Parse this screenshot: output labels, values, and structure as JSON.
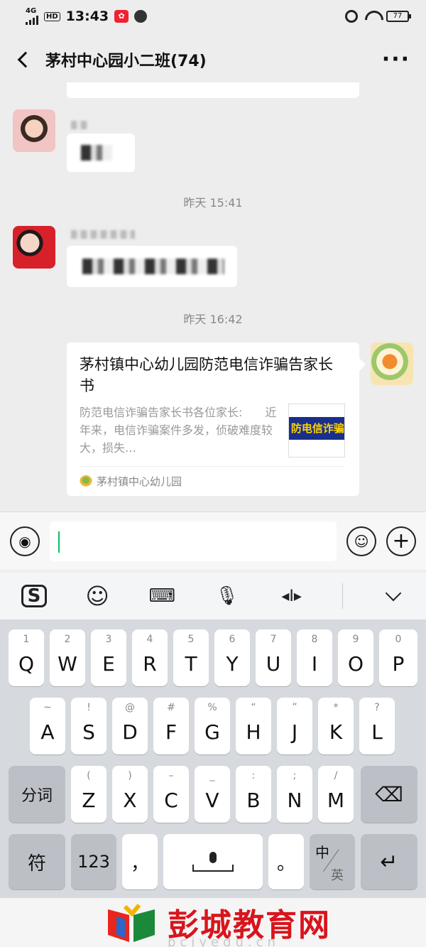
{
  "status": {
    "network": "4G",
    "hd": "HD",
    "time": "13:43",
    "battery": "77"
  },
  "header": {
    "title": "茅村中心园小二班(74)"
  },
  "chat": {
    "timestamps": [
      "昨天 15:41",
      "昨天 16:42"
    ],
    "card": {
      "title": "茅村镇中心幼儿园防范电信诈骗告家长书",
      "description": "防范电信诈骗告家长书各位家长:　　近年来，电信诈骗案件多发，侦破难度较大，损失…",
      "thumb_text": "防电信诈骗",
      "source": "茅村镇中心幼儿园"
    }
  },
  "keyboard": {
    "row1": [
      {
        "num": "1",
        "letter": "Q"
      },
      {
        "num": "2",
        "letter": "W"
      },
      {
        "num": "3",
        "letter": "E"
      },
      {
        "num": "4",
        "letter": "R"
      },
      {
        "num": "5",
        "letter": "T"
      },
      {
        "num": "6",
        "letter": "Y"
      },
      {
        "num": "7",
        "letter": "U"
      },
      {
        "num": "8",
        "letter": "I"
      },
      {
        "num": "9",
        "letter": "O"
      },
      {
        "num": "0",
        "letter": "P"
      }
    ],
    "row2": [
      {
        "num": "~",
        "letter": "A"
      },
      {
        "num": "!",
        "letter": "S"
      },
      {
        "num": "@",
        "letter": "D"
      },
      {
        "num": "#",
        "letter": "F"
      },
      {
        "num": "%",
        "letter": "G"
      },
      {
        "num": "“",
        "letter": "H"
      },
      {
        "num": "”",
        "letter": "J"
      },
      {
        "num": "*",
        "letter": "K"
      },
      {
        "num": "?",
        "letter": "L"
      }
    ],
    "row3": [
      {
        "num": "(",
        "letter": "Z"
      },
      {
        "num": ")",
        "letter": "X"
      },
      {
        "num": "–",
        "letter": "C"
      },
      {
        "num": "_",
        "letter": "V"
      },
      {
        "num": ":",
        "letter": "B"
      },
      {
        "num": ";",
        "letter": "N"
      },
      {
        "num": "/",
        "letter": "M"
      }
    ],
    "fenci": "分词",
    "fu": "符",
    "num123": "123",
    "comma": "，",
    "period": "。",
    "zh": "中",
    "en": "英"
  },
  "watermark": {
    "text": "彭城教育网",
    "url": "pcjyedu.cn"
  }
}
